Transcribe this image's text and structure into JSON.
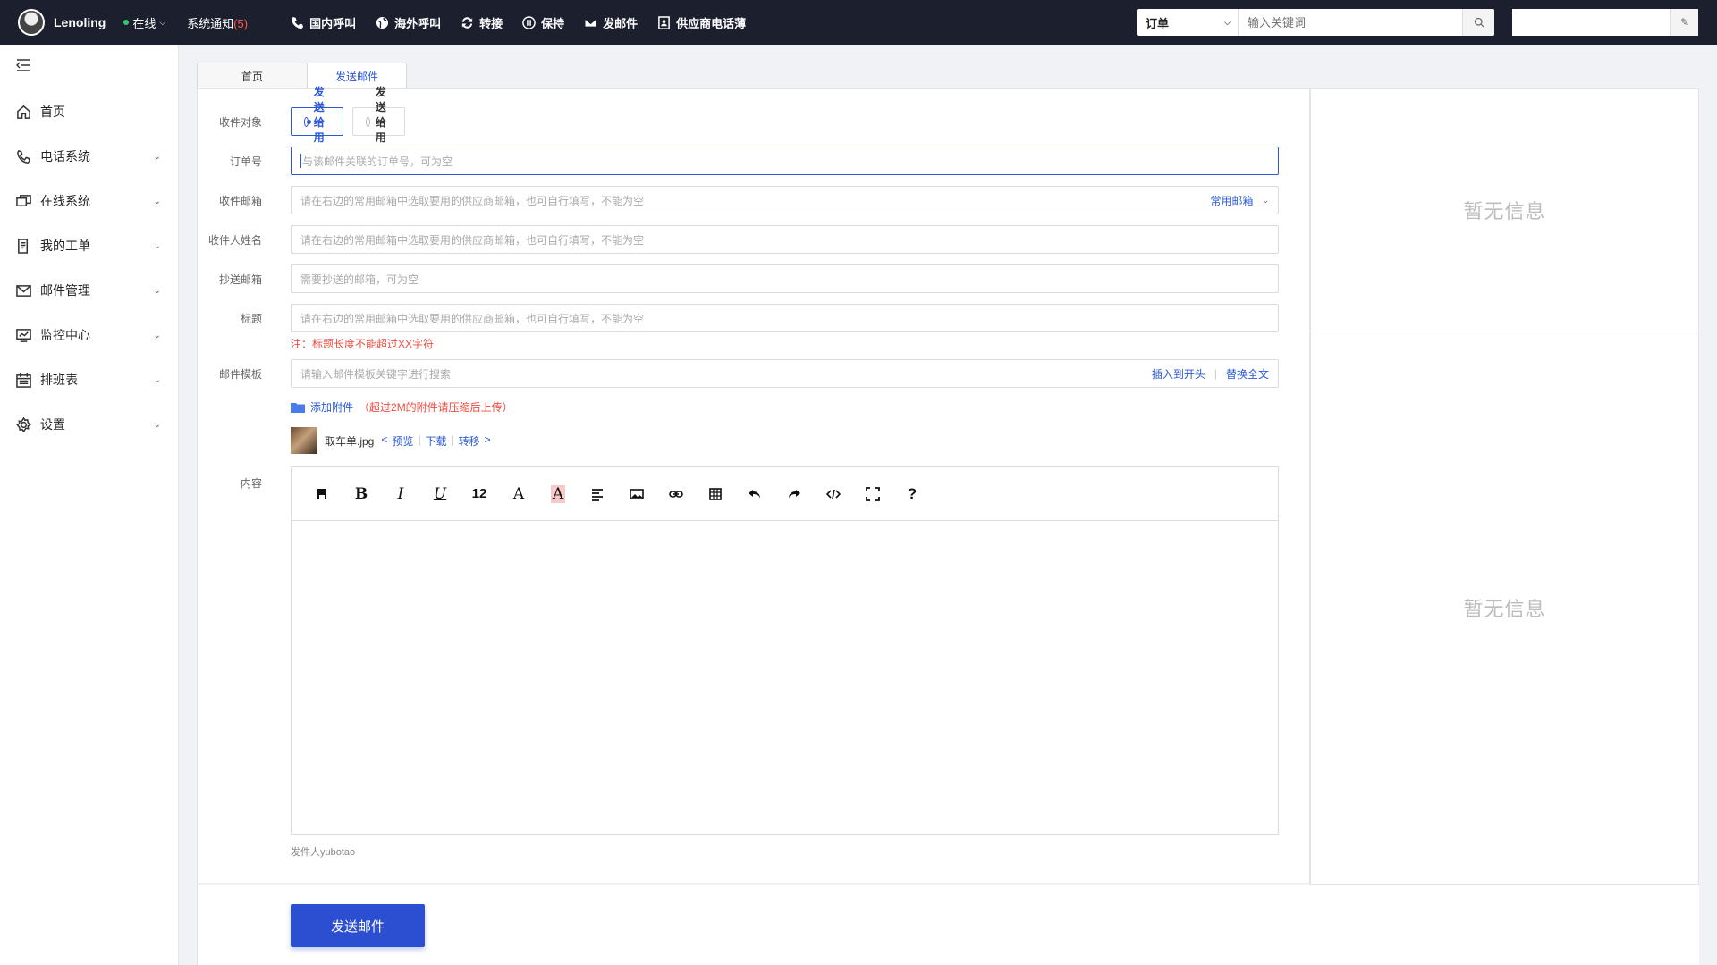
{
  "user": {
    "name": "Lenoling",
    "status": "在线"
  },
  "notice": {
    "label": "系统通知",
    "count": "(5)"
  },
  "actions": [
    {
      "label": "国内呼叫",
      "icon": "phone-icon"
    },
    {
      "label": "海外呼叫",
      "icon": "globe-icon"
    },
    {
      "label": "转接",
      "icon": "transfer-icon"
    },
    {
      "label": "保持",
      "icon": "hold-icon"
    },
    {
      "label": "发邮件",
      "icon": "mail-icon"
    },
    {
      "label": "供应商电话薄",
      "icon": "contacts-icon"
    }
  ],
  "search": {
    "category": "订单",
    "placeholder": "输入关键词"
  },
  "sidebar": {
    "items": [
      {
        "label": "首页",
        "icon": "home-icon"
      },
      {
        "label": "电话系统",
        "icon": "phone-icon"
      },
      {
        "label": "在线系统",
        "icon": "chat-icon"
      },
      {
        "label": "我的工单",
        "icon": "ticket-icon"
      },
      {
        "label": "邮件管理",
        "icon": "mail-icon"
      },
      {
        "label": "监控中心",
        "icon": "monitor-icon"
      },
      {
        "label": "排班表",
        "icon": "calendar-icon"
      },
      {
        "label": "设置",
        "icon": "gear-icon"
      }
    ]
  },
  "tabs": [
    {
      "label": "首页"
    },
    {
      "label": "发送邮件"
    }
  ],
  "form": {
    "recipient_label": "收件对象",
    "recipient_options": [
      "发送给用户",
      "发送给用户"
    ],
    "order_label": "订单号",
    "order_placeholder": "与该邮件关联的订单号，可为空",
    "email_label": "收件邮箱",
    "email_placeholder": "请在右边的常用邮箱中选取要用的供应商邮箱，也可自行填写，不能为空",
    "email_suffix": "常用邮箱",
    "name_label": "收件人姓名",
    "name_placeholder": "请在右边的常用邮箱中选取要用的供应商邮箱，也可自行填写，不能为空",
    "cc_label": "抄送邮箱",
    "cc_placeholder": "需要抄送的邮箱，可为空",
    "subject_label": "标题",
    "subject_placeholder": "请在右边的常用邮箱中选取要用的供应商邮箱，也可自行填写，不能为空",
    "subject_warning": "注：标题长度不能超过XX字符",
    "template_label": "邮件模板",
    "template_placeholder": "请输入邮件模板关键字进行搜索",
    "template_insert": "插入到开头",
    "template_replace": "替换全文",
    "attach_label": "添加附件",
    "attach_note": "（超过2M的附件请压缩后上传）",
    "file_name": "取车单.jpg",
    "file_ops": {
      "preview": "预览",
      "download": "下载",
      "move": "转移"
    },
    "content_label": "内容",
    "sender": "发件人yubotao",
    "submit": "发送邮件"
  },
  "editor_tools": [
    {
      "name": "save-icon",
      "glyph": ""
    },
    {
      "name": "bold-icon",
      "glyph": "B"
    },
    {
      "name": "italic-icon",
      "glyph": "I"
    },
    {
      "name": "underline-icon",
      "glyph": "U"
    },
    {
      "name": "font-size-icon",
      "glyph": "12"
    },
    {
      "name": "font-color-icon",
      "glyph": "A"
    },
    {
      "name": "highlight-icon",
      "glyph": "A"
    },
    {
      "name": "align-icon",
      "glyph": ""
    },
    {
      "name": "image-icon",
      "glyph": ""
    },
    {
      "name": "link-icon",
      "glyph": ""
    },
    {
      "name": "table-icon",
      "glyph": ""
    },
    {
      "name": "undo-icon",
      "glyph": ""
    },
    {
      "name": "redo-icon",
      "glyph": ""
    },
    {
      "name": "code-icon",
      "glyph": ""
    },
    {
      "name": "fullscreen-icon",
      "glyph": ""
    },
    {
      "name": "help-icon",
      "glyph": "?"
    }
  ],
  "panels": {
    "empty_top": "暂无信息",
    "empty_bottom": "暂无信息"
  },
  "colors": {
    "accent": "#2b59d6",
    "topbar": "#1b1f2e",
    "warning": "#f04a3e",
    "online": "#2ecc71"
  }
}
